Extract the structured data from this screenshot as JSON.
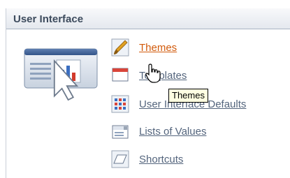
{
  "section": {
    "title": "User Interface"
  },
  "items": [
    {
      "label": "Themes",
      "icon": "paintbrush-icon",
      "active": true
    },
    {
      "label": "Templates",
      "icon": "template-window-icon"
    },
    {
      "label": "User Interface Defaults",
      "icon": "grid-table-icon"
    },
    {
      "label": "Lists of Values",
      "icon": "list-dropdown-icon"
    },
    {
      "label": "Shortcuts",
      "icon": "shortcut-parallelogram-icon"
    }
  ],
  "tooltip": {
    "text": "Themes"
  },
  "colors": {
    "link": "#54657d",
    "link_active": "#d25b0c",
    "title_text": "#3d4b5d"
  }
}
